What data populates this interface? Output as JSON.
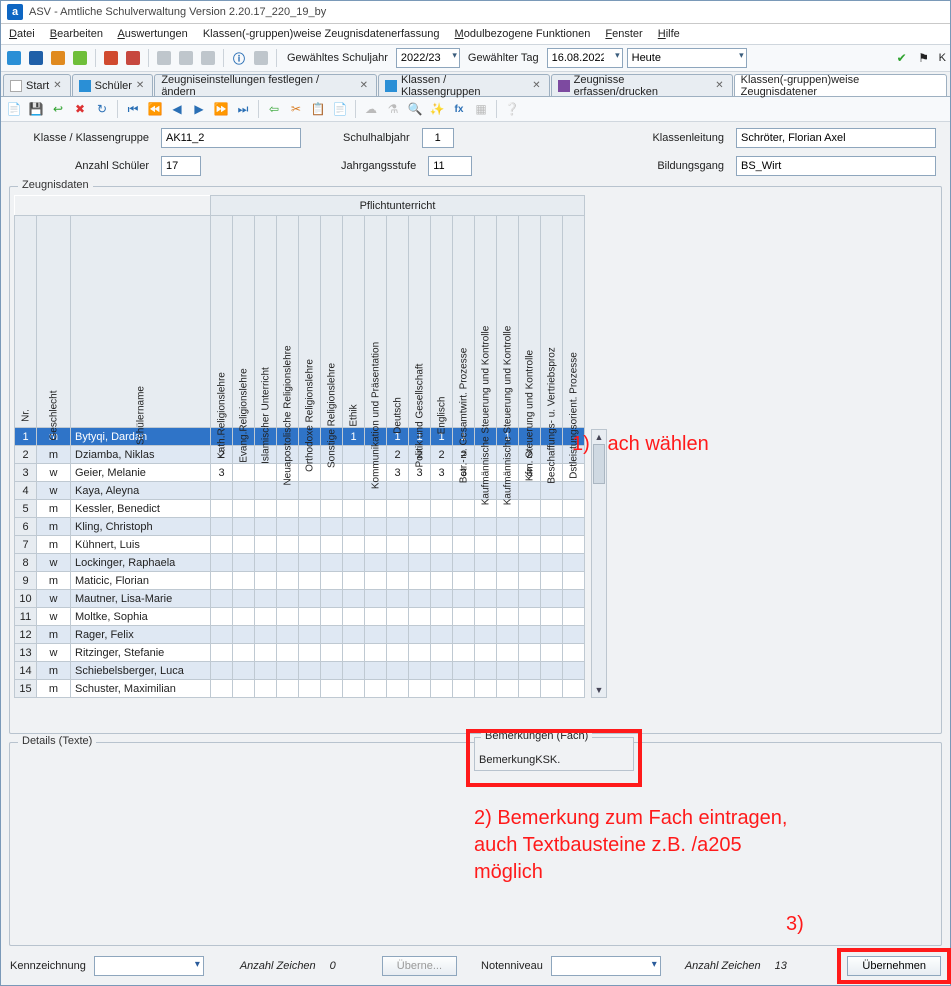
{
  "title": "ASV - Amtliche Schulverwaltung Version 2.20.17_220_19_by",
  "menu": [
    "Datei",
    "Bearbeiten",
    "Auswertungen",
    "Klassen(-gruppen)weise Zeugnisdatenerfassung",
    "Modulbezogene Funktionen",
    "Fenster",
    "Hilfe"
  ],
  "toolbar1": {
    "schuljahr_label": "Gewähltes Schuljahr",
    "schuljahr_value": "2022/23",
    "tag_label": "Gewählter Tag",
    "tag_value": "16.08.2022",
    "heute_label": "Heute"
  },
  "tabs": [
    {
      "label": "Start",
      "active": false,
      "closable": true
    },
    {
      "label": "Schüler",
      "active": false,
      "closable": true
    },
    {
      "label": "Zeugniseinstellungen festlegen / ändern",
      "active": false,
      "closable": true
    },
    {
      "label": "Klassen / Klassengruppen",
      "active": false,
      "closable": true
    },
    {
      "label": "Zeugnisse erfassen/drucken",
      "active": false,
      "closable": true
    },
    {
      "label": "Klassen(-gruppen)weise Zeugnisdatener",
      "active": true,
      "closable": false
    }
  ],
  "form": {
    "klasse_label": "Klasse / Klassengruppe",
    "klasse_value": "AK11_2",
    "halbjahr_label": "Schulhalbjahr",
    "halbjahr_value": "1",
    "leitung_label": "Klassenleitung",
    "leitung_value": "Schröter, Florian Axel",
    "anzahl_label": "Anzahl Schüler",
    "anzahl_value": "17",
    "stufe_label": "Jahrgangsstufe",
    "stufe_value": "11",
    "bildungsgang_label": "Bildungsgang",
    "bildungsgang_value": "BS_Wirt"
  },
  "fieldset_title": "Zeugnisdaten",
  "group_header": "Pflichtunterricht",
  "left_cols": [
    "Nr.",
    "Geschlecht",
    "Schülername"
  ],
  "subject_cols": [
    "Kath.Religionslehre",
    "Evang.Religionslehre",
    "Islamischer Unterricht",
    "Neuapostolische Religionslehre",
    "Orthodoxe Religionslehre",
    "Sonstige Religionslehre",
    "Ethik",
    "Kommunikation und Präsentation",
    "Deutsch",
    "Politik und Gesellschaft",
    "Englisch",
    "Betr.- u. Gesamtwirt. Prozesse",
    "Kaufmännische Steuerung und Kontrolle",
    "Kaufmännische Steuerung und Kontrolle",
    "Kfm. Steuerung und Kontrolle",
    "Beschaffungs- u. Vertriebsproz",
    "Dstleistungsorient. Prozesse"
  ],
  "rows": [
    {
      "nr": "1",
      "sex": "m",
      "name": "Bytyqi, Dardan",
      "sel": true,
      "cells": [
        "",
        "",
        "",
        "",
        "",
        "",
        "1",
        "",
        "1",
        "1",
        "1",
        "1",
        "",
        "1",
        "",
        "",
        ""
      ],
      "selcell": 13
    },
    {
      "nr": "2",
      "sex": "m",
      "name": "Dziamba, Niklas",
      "cells": [
        "2",
        "",
        "",
        "",
        "",
        "",
        "",
        "",
        "2",
        "2",
        "2",
        "2",
        "",
        "",
        "2",
        "",
        ""
      ]
    },
    {
      "nr": "3",
      "sex": "w",
      "name": "Geier, Melanie",
      "cells": [
        "3",
        "",
        "",
        "",
        "",
        "",
        "",
        "",
        "3",
        "3",
        "3",
        "3",
        "",
        "",
        "3",
        "",
        ""
      ]
    },
    {
      "nr": "4",
      "sex": "w",
      "name": "Kaya, Aleyna",
      "cells": [
        "",
        "",
        "",
        "",
        "",
        "",
        "",
        "",
        "",
        "",
        "",
        "",
        "",
        "",
        "",
        "",
        ""
      ]
    },
    {
      "nr": "5",
      "sex": "m",
      "name": "Kessler, Benedict",
      "cells": [
        "",
        "",
        "",
        "",
        "",
        "",
        "",
        "",
        "",
        "",
        "",
        "",
        "",
        "",
        "",
        "",
        ""
      ]
    },
    {
      "nr": "6",
      "sex": "m",
      "name": "Kling, Christoph",
      "cells": [
        "",
        "",
        "",
        "",
        "",
        "",
        "",
        "",
        "",
        "",
        "",
        "",
        "",
        "",
        "",
        "",
        ""
      ]
    },
    {
      "nr": "7",
      "sex": "m",
      "name": "Kühnert, Luis",
      "cells": [
        "",
        "",
        "",
        "",
        "",
        "",
        "",
        "",
        "",
        "",
        "",
        "",
        "",
        "",
        "",
        "",
        ""
      ]
    },
    {
      "nr": "8",
      "sex": "w",
      "name": "Lockinger, Raphaela",
      "cells": [
        "",
        "",
        "",
        "",
        "",
        "",
        "",
        "",
        "",
        "",
        "",
        "",
        "",
        "",
        "",
        "",
        ""
      ]
    },
    {
      "nr": "9",
      "sex": "m",
      "name": "Maticic, Florian",
      "cells": [
        "",
        "",
        "",
        "",
        "",
        "",
        "",
        "",
        "",
        "",
        "",
        "",
        "",
        "",
        "",
        "",
        ""
      ]
    },
    {
      "nr": "10",
      "sex": "w",
      "name": "Mautner, Lisa-Marie",
      "cells": [
        "",
        "",
        "",
        "",
        "",
        "",
        "",
        "",
        "",
        "",
        "",
        "",
        "",
        "",
        "",
        "",
        ""
      ]
    },
    {
      "nr": "11",
      "sex": "w",
      "name": "Moltke, Sophia",
      "cells": [
        "",
        "",
        "",
        "",
        "",
        "",
        "",
        "",
        "",
        "",
        "",
        "",
        "",
        "",
        "",
        "",
        ""
      ]
    },
    {
      "nr": "12",
      "sex": "m",
      "name": "Rager, Felix",
      "cells": [
        "",
        "",
        "",
        "",
        "",
        "",
        "",
        "",
        "",
        "",
        "",
        "",
        "",
        "",
        "",
        "",
        ""
      ]
    },
    {
      "nr": "13",
      "sex": "w",
      "name": "Ritzinger, Stefanie",
      "cells": [
        "",
        "",
        "",
        "",
        "",
        "",
        "",
        "",
        "",
        "",
        "",
        "",
        "",
        "",
        "",
        "",
        ""
      ]
    },
    {
      "nr": "14",
      "sex": "m",
      "name": "Schiebelsberger, Luca",
      "cells": [
        "",
        "",
        "",
        "",
        "",
        "",
        "",
        "",
        "",
        "",
        "",
        "",
        "",
        "",
        "",
        "",
        ""
      ]
    },
    {
      "nr": "15",
      "sex": "m",
      "name": "Schuster, Maximilian",
      "cells": [
        "",
        "",
        "",
        "",
        "",
        "",
        "",
        "",
        "",
        "",
        "",
        "",
        "",
        "",
        "",
        "",
        ""
      ]
    }
  ],
  "annotations": {
    "a1": "1) Fach wählen",
    "a2": "2) Bemerkung zum Fach eintragen, auch Textbausteine z.B. /a205 möglich",
    "a3": "3)"
  },
  "details_title": "Details (Texte)",
  "bemerkungen": {
    "title": "Bemerkungen (Fach)",
    "value": "BemerkungKSK."
  },
  "bottom": {
    "kennzeichnung_label": "Kennzeichnung",
    "kennzeichnung_value": "",
    "anzahl_zeichen_label": "Anzahl Zeichen",
    "anzahl_zeichen_left": "0",
    "ueberne_label": "Überne...",
    "notenniveau_label": "Notenniveau",
    "notenniveau_value": "",
    "anzahl_zeichen_right": "13",
    "uebernehmen_label": "Übernehmen"
  }
}
